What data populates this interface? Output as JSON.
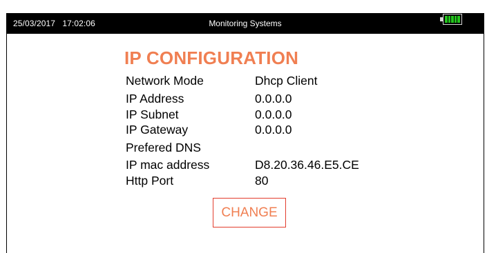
{
  "status_bar": {
    "datetime": "25/03/2017   17:02:06",
    "title": "Monitoring Systems",
    "battery_icon": "battery-full-icon",
    "battery_color": "#22c41c",
    "battery_level": 1.0
  },
  "page": {
    "title": "IP CONFIGURATION",
    "title_color": "#f07f52"
  },
  "config": {
    "rows": [
      {
        "label": "Network Mode",
        "value": "Dhcp Client"
      },
      {
        "label": "IP Address",
        "value": "0.0.0.0"
      },
      {
        "label": "IP Subnet",
        "value": "0.0.0.0"
      },
      {
        "label": "IP Gateway",
        "value": "0.0.0.0"
      },
      {
        "label": "Prefered DNS",
        "value": ""
      },
      {
        "label": "IP mac address",
        "value": "D8.20.36.46.E5.CE"
      },
      {
        "label": "Http Port",
        "value": "80"
      }
    ]
  },
  "actions": {
    "change_label": "CHANGE",
    "change_border_color": "#e23c2c"
  }
}
